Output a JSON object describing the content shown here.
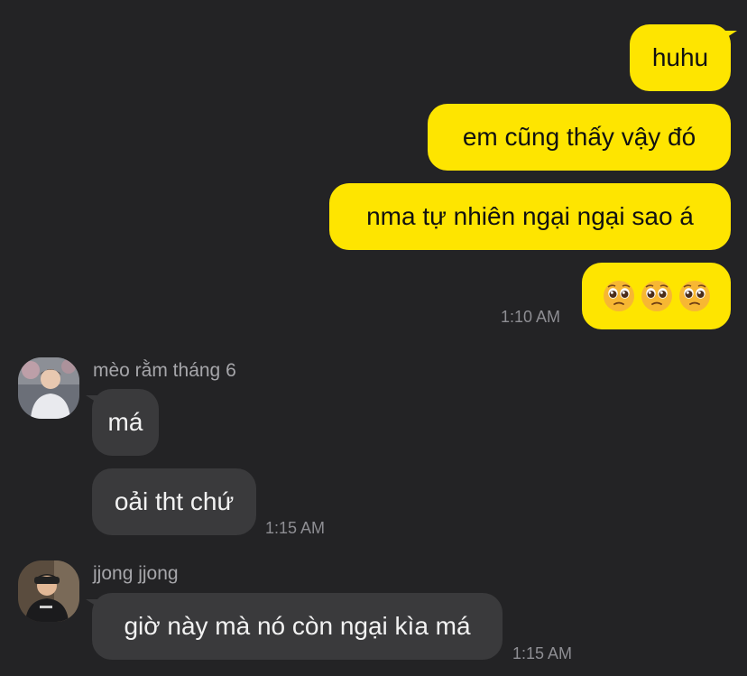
{
  "outgoing": [
    {
      "text": "huhu"
    },
    {
      "text": "em cũng thấy vậy đó"
    },
    {
      "text": "nma tự nhiên ngại ngại sao á"
    },
    {
      "emojis": [
        "pleading-face",
        "pleading-face",
        "pleading-face"
      ],
      "time": "1:10 AM"
    }
  ],
  "groups": [
    {
      "sender": "mèo rằm tháng 6",
      "avatar": "avatar-meo",
      "messages": [
        {
          "text": "má"
        },
        {
          "text": "oải tht chứ",
          "time": "1:15 AM"
        }
      ]
    },
    {
      "sender": "jjong jjong",
      "avatar": "avatar-jjong",
      "messages": [
        {
          "text": "giờ này mà nó còn ngại kìa má",
          "time": "1:15 AM"
        }
      ]
    }
  ],
  "colors": {
    "background": "#232325",
    "outgoing_bubble": "#fee500",
    "incoming_bubble": "#3a3a3c",
    "timestamp": "#8e8e93",
    "sender_name": "#a6a6aa"
  }
}
